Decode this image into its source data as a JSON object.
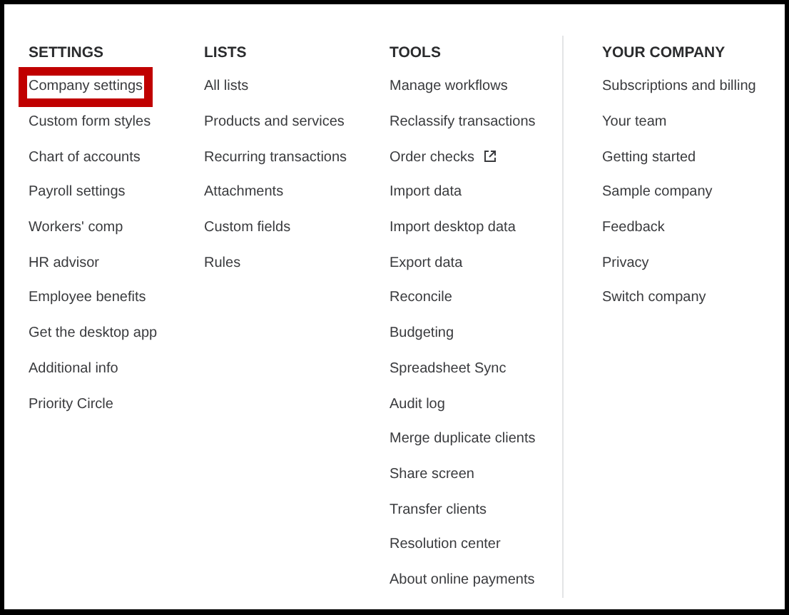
{
  "columns": [
    {
      "heading": "SETTINGS",
      "divider": false,
      "items": [
        {
          "label": "Company settings",
          "highlighted": true,
          "external": false
        },
        {
          "label": "Custom form styles",
          "highlighted": false,
          "external": false
        },
        {
          "label": "Chart of accounts",
          "highlighted": false,
          "external": false
        },
        {
          "label": "Payroll settings",
          "highlighted": false,
          "external": false
        },
        {
          "label": "Workers' comp",
          "highlighted": false,
          "external": false
        },
        {
          "label": "HR advisor",
          "highlighted": false,
          "external": false
        },
        {
          "label": "Employee benefits",
          "highlighted": false,
          "external": false
        },
        {
          "label": "Get the desktop app",
          "highlighted": false,
          "external": false
        },
        {
          "label": "Additional info",
          "highlighted": false,
          "external": false
        },
        {
          "label": "Priority Circle",
          "highlighted": false,
          "external": false
        }
      ]
    },
    {
      "heading": "LISTS",
      "divider": false,
      "items": [
        {
          "label": "All lists",
          "highlighted": false,
          "external": false
        },
        {
          "label": "Products and services",
          "highlighted": false,
          "external": false
        },
        {
          "label": "Recurring transactions",
          "highlighted": false,
          "external": false
        },
        {
          "label": "Attachments",
          "highlighted": false,
          "external": false
        },
        {
          "label": "Custom fields",
          "highlighted": false,
          "external": false
        },
        {
          "label": "Rules",
          "highlighted": false,
          "external": false
        }
      ]
    },
    {
      "heading": "TOOLS",
      "divider": true,
      "items": [
        {
          "label": "Manage workflows",
          "highlighted": false,
          "external": false
        },
        {
          "label": "Reclassify transactions",
          "highlighted": false,
          "external": false
        },
        {
          "label": "Order checks",
          "highlighted": false,
          "external": true
        },
        {
          "label": "Import data",
          "highlighted": false,
          "external": false
        },
        {
          "label": "Import desktop data",
          "highlighted": false,
          "external": false
        },
        {
          "label": "Export data",
          "highlighted": false,
          "external": false
        },
        {
          "label": "Reconcile",
          "highlighted": false,
          "external": false
        },
        {
          "label": "Budgeting",
          "highlighted": false,
          "external": false
        },
        {
          "label": "Spreadsheet Sync",
          "highlighted": false,
          "external": false
        },
        {
          "label": "Audit log",
          "highlighted": false,
          "external": false
        },
        {
          "label": "Merge duplicate clients",
          "highlighted": false,
          "external": false
        },
        {
          "label": "Share screen",
          "highlighted": false,
          "external": false
        },
        {
          "label": "Transfer clients",
          "highlighted": false,
          "external": false
        },
        {
          "label": "Resolution center",
          "highlighted": false,
          "external": false
        },
        {
          "label": "About online payments",
          "highlighted": false,
          "external": false
        }
      ]
    },
    {
      "heading": "YOUR COMPANY",
      "divider": false,
      "items": [
        {
          "label": "Subscriptions and billing",
          "highlighted": false,
          "external": false
        },
        {
          "label": "Your team",
          "highlighted": false,
          "external": false
        },
        {
          "label": "Getting started",
          "highlighted": false,
          "external": false
        },
        {
          "label": "Sample company",
          "highlighted": false,
          "external": false
        },
        {
          "label": "Feedback",
          "highlighted": false,
          "external": false
        },
        {
          "label": "Privacy",
          "highlighted": false,
          "external": false
        },
        {
          "label": "Switch company",
          "highlighted": false,
          "external": false
        }
      ]
    }
  ]
}
